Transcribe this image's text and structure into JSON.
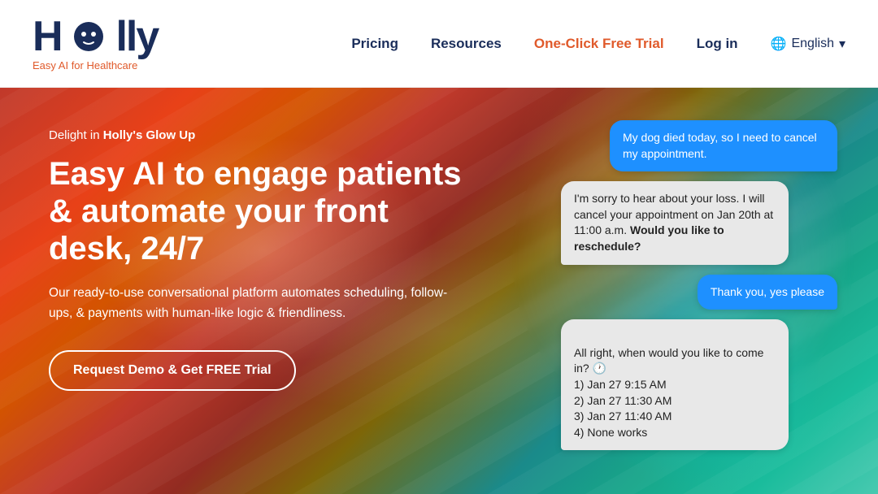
{
  "nav": {
    "logo_text": "Holly",
    "logo_tagline": "Easy AI for Healthcare",
    "links": [
      {
        "label": "Pricing",
        "id": "pricing"
      },
      {
        "label": "Resources",
        "id": "resources"
      },
      {
        "label": "One-Click Free Trial",
        "id": "trial"
      },
      {
        "label": "Log in",
        "id": "login"
      }
    ],
    "lang_label": "English",
    "lang_icon": "🌐"
  },
  "hero": {
    "label_prefix": "Delight in ",
    "label_strong": "Holly's Glow Up",
    "title": "Easy AI to engage patients & automate your front desk, 24/7",
    "description": "Our ready-to-use conversational platform automates scheduling, follow-ups, & payments with human-like logic & friendliness.",
    "cta_button": "Request Demo & Get FREE Trial"
  },
  "chat": {
    "bubbles": [
      {
        "type": "right",
        "text": "My dog died today, so I need to cancel my appointment."
      },
      {
        "type": "left",
        "text_plain": "I'm sorry to hear about your loss. I will cancel your appointment on Jan 20th at 11:00 a.m. ",
        "text_bold": "Would you like to reschedule?"
      },
      {
        "type": "right",
        "text": "Thank you, yes please"
      },
      {
        "type": "left",
        "text": "All right, when would you like to come in? 🕐\n1) Jan 27 9:15 AM\n2) Jan 27 11:30 AM\n3) Jan 27 11:40 AM\n4) None works"
      }
    ]
  }
}
